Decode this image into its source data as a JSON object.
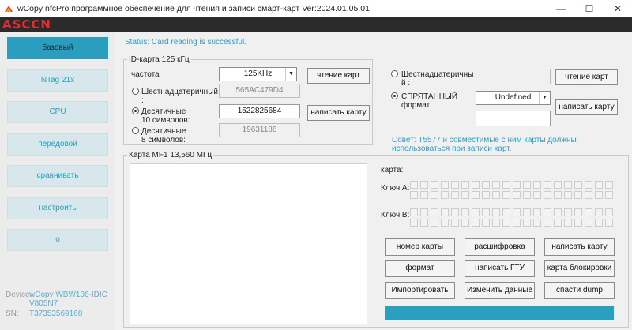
{
  "window": {
    "title": "wCopy nfcPro программное обеспечение для чтения и записи смарт-карт  Ver:2024.01.05.01",
    "minimize": "—",
    "maximize": "☐",
    "close": "✕"
  },
  "brand": {
    "logo": "ASCCN"
  },
  "sidebar": {
    "items": [
      {
        "label": "базовый"
      },
      {
        "label": "NTag 21x"
      },
      {
        "label": "CPU"
      },
      {
        "label": "передовой"
      },
      {
        "label": "сравнивать"
      },
      {
        "label": "настроить"
      },
      {
        "label": "о"
      }
    ],
    "device_label": "Device:",
    "device_value": "wCopy WBW106-IDIC V805N7",
    "sn_label": "SN:",
    "sn_value": "T37353569168"
  },
  "status": "Status: Card reading is successful.",
  "id_card": {
    "legend": "ID-карта 125 кГц",
    "freq_label": "частота",
    "freq_value": "125KHz",
    "hex_label": "Шестнадцатеричный",
    "hex_colon": ":",
    "hex_value": "565AC479D4",
    "dec10_label1": "Десятичные",
    "dec10_label2": "10 символов:",
    "dec10_value": "1522825684",
    "dec8_label1": "Десятичные",
    "dec8_label2": "8 символов:",
    "dec8_value": "19631188",
    "read_button": "чтение карт",
    "write_button": "написать карту"
  },
  "right_panel": {
    "hex_label1": "Шестнадцатеричны",
    "hex_label2": "й :",
    "hex_value": "",
    "read_button": "чтение карт",
    "hidden_label1": "СПРЯТАННЫЙ",
    "hidden_label2": "формат",
    "format_value": "Undefined",
    "extra_value": "",
    "write_button": "написать карту",
    "tip": "Совет: T5577 и совместимые с ним карты должны использоваться при записи карт."
  },
  "mf1": {
    "legend": "Карта MF1 13,560 МГц",
    "card_label": "карта:",
    "keyA_label": "Ключ A:",
    "keyB_label": "Ключ B:",
    "buttons": [
      "номер карты",
      "расшифровка",
      "написать карту",
      "формат",
      "написать ГТУ",
      "карта блокировки",
      "Импортировать",
      "Изменить данные",
      "спасти dump"
    ]
  }
}
